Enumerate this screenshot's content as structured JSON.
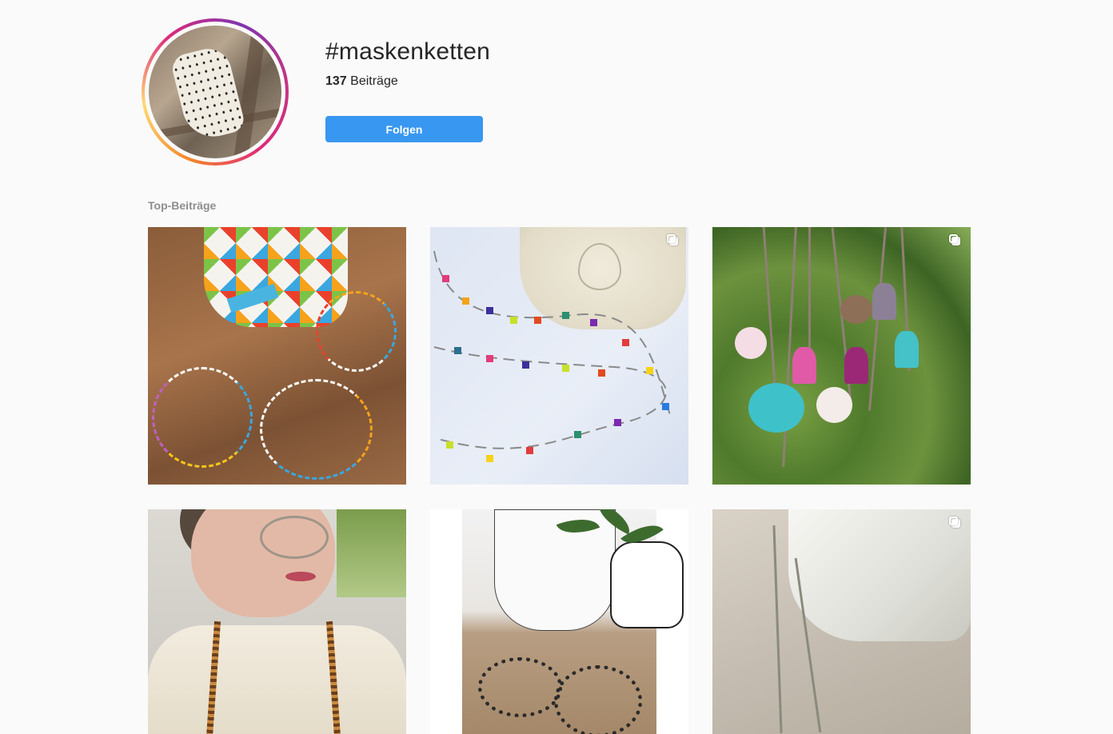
{
  "header": {
    "hashtag": "#maskenketten",
    "post_count": "137",
    "post_label": "Beiträge",
    "follow_label": "Folgen"
  },
  "section": {
    "title": "Top-Beiträge"
  },
  "posts": [
    {
      "type": "multi-photo",
      "multi_icon": false
    },
    {
      "type": "multi-photo",
      "multi_icon": true
    },
    {
      "type": "multi-photo",
      "multi_icon": true
    },
    {
      "type": "photo",
      "multi_icon": false
    },
    {
      "type": "photo",
      "multi_icon": false
    },
    {
      "type": "multi-photo",
      "multi_icon": true
    }
  ],
  "colors": {
    "accent": "#3897f0",
    "background": "#fafafa",
    "muted_text": "#8e8e8e"
  },
  "icons": {
    "multi_post": "copy-icon"
  }
}
